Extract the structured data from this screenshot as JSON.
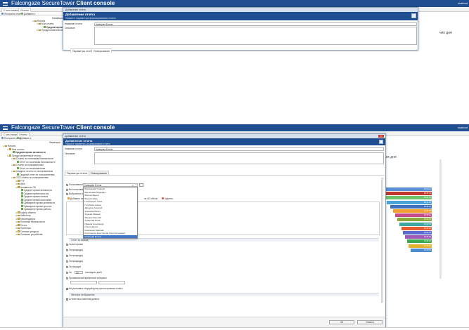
{
  "app": {
    "title_light": "Falcongaze Secure",
    "title_mid": "Tower",
    "title_bold": "Client console",
    "login": "localhost"
  },
  "tabs": [
    {
      "label": "С чего начать"
    },
    {
      "label": "Отчеты"
    }
  ],
  "toolbar": {
    "build_label": "Построить отчет",
    "add_label": "Добавить ▾"
  },
  "panel_header": "Навигация",
  "tree": {
    "root": "Reports",
    "my_reports": "Мои отчеты",
    "avg_time": "Средняя время активности",
    "predefined": "Предустановленные отчеты",
    "by_policies": "Отчеты по политикам безопасности",
    "policy_report": "Отчет по политикам безопасности",
    "by_users": "Отчеты по пользователям",
    "user_report": "Отчет по пользователям",
    "summary": "Сводные отчеты по пользователям",
    "summary_item": "Сводный отчет по пользователям",
    "top": "ТОП-отчеты по пользователям",
    "ftp": "FTP",
    "web": "Web",
    "pc_activity": "Активность ПК",
    "pc_items": [
      "Среднее время активности",
      "Среднее время простоя",
      "Среднее время начала",
      "Среднее время окончания",
      "Суммарное время активности",
      "Суммарное время простоя",
      "Суммарное время работы"
    ],
    "rest": [
      "Буфер обмена",
      "Кейлоггер",
      "Мессенджеры",
      "Политики безопасности",
      "Почта",
      "Принтеры",
      "Сетевые ресурсы",
      "Съемные устройства"
    ]
  },
  "right_heading_fragment": "чих дня",
  "dialog": {
    "caption": "Добавление отчёта",
    "close_label": "✕",
    "heading": "Добавление отчёта",
    "subheading": "Укажите параметры формирования отчета",
    "name_label": "Название отчета",
    "name_value": "Кравцова Елена",
    "desc_label": "Описание",
    "tab_params": "Параметры отчета",
    "tab_schedule": "Планирование"
  },
  "filter": {
    "users_label": "Пользователь",
    "users_value": "Кравцова Елена",
    "all_users": "Все пользователи",
    "selected": "Выбранные пол",
    "add_label": "Добавить по",
    "ad_label": "из AD объект",
    "delete_label": "Удалить"
  },
  "dropdown": [
    "Бурковский Георгий",
    "Васильева Надежда",
    "Вегров Федор",
    "Волков Иван",
    "Гончаренко Анна",
    "Голубева Алина",
    "Дроздов Алексей",
    "Жданова Юлия",
    "Жукова Михаил",
    "Зверев Николай",
    "Зубарева Инна",
    "Иванов Александр",
    "Ильин Денис",
    "Казаченко Марина",
    "Константин Константин Константинович",
    "Кравцова Елена"
  ],
  "period": {
    "section": "Отчет за период",
    "all_time": "За всё время",
    "prev1": "За предыдущ",
    "prev2": "За предыдущ",
    "prev3": "За предыдущ",
    "prev4": "За текущий",
    "last_days_prefix": "За",
    "last_days_value": "30",
    "last_days_suffix": "последних дней",
    "custom": "Произвольный временной интервал",
    "no_current": "Не учитывать текущий день при построении отчёта"
  },
  "filters": {
    "section": "Фильтры отображения",
    "count": "Статистика значения данных"
  },
  "buttons": {
    "ok": "ОК",
    "cancel": "Отмена"
  },
  "bars": [
    {
      "value": "03:44:11",
      "color": "#5b8fd6",
      "frac": 1.0
    },
    {
      "value": "03:45:41",
      "color": "#c0392b",
      "frac": 0.96
    },
    {
      "value": "03:28:13",
      "color": "#6fc46b",
      "frac": 0.9
    },
    {
      "value": "03:14:08",
      "color": "#4aa3d9",
      "frac": 0.86
    },
    {
      "value": "02:59:01",
      "color": "#3f6fbe",
      "frac": 0.8
    },
    {
      "value": "02:45:33",
      "color": "#f0a030",
      "frac": 0.74
    },
    {
      "value": "02:40:12",
      "color": "#c74a8a",
      "frac": 0.7
    },
    {
      "value": "02:31:40",
      "color": "#8aa93a",
      "frac": 0.66
    },
    {
      "value": "02:22:05",
      "color": "#3fa7a0",
      "frac": 0.62
    },
    {
      "value": "02:11:50",
      "color": "#e65c2f",
      "frac": 0.58
    },
    {
      "value": "02:05:41",
      "color": "#5a6bd1",
      "frac": 0.55
    },
    {
      "value": "01:56:30",
      "color": "#9c59b6",
      "frac": 0.51
    },
    {
      "value": "01:48:22",
      "color": "#3aa74e",
      "frac": 0.47
    },
    {
      "value": "01:40:10",
      "color": "#e0b12c",
      "frac": 0.44
    },
    {
      "value": "01:33:00",
      "color": "#4b8bd0",
      "frac": 0.41
    }
  ]
}
